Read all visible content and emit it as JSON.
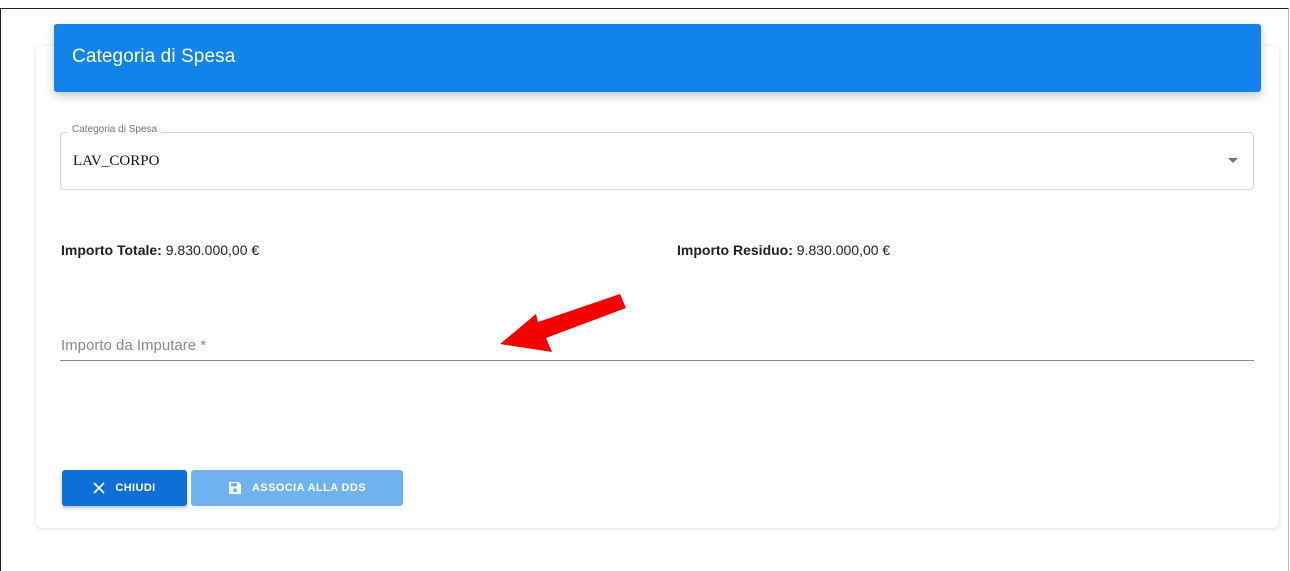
{
  "header": {
    "title": "Categoria di Spesa"
  },
  "category_select": {
    "label": "Categoria di Spesa",
    "value": "LAV_CORPO"
  },
  "amounts": {
    "total_label": "Importo Totale:",
    "total_value": "9.830.000,00 €",
    "residual_label": "Importo Residuo:",
    "residual_value": "9.830.000,00 €"
  },
  "amount_input": {
    "placeholder": "Importo da Imputare *",
    "value": ""
  },
  "buttons": {
    "close_label": "CHIUDI",
    "associate_label": "ASSOCIA ALLA DDS"
  },
  "icons": {
    "close": "close-icon",
    "save": "floppy-disk-icon",
    "dropdown": "chevron-down-icon",
    "annotation": "red-arrow"
  },
  "colors": {
    "primary": "#1283ea",
    "button_primary": "#0d6fd8",
    "button_disabled": "#6db3ef",
    "annotation_arrow": "#f50000"
  }
}
